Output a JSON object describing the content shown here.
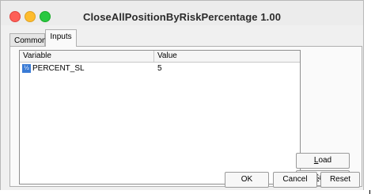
{
  "window": {
    "title": "CloseAllPositionByRiskPercentage 1.00"
  },
  "tabs": [
    {
      "label": "Common"
    },
    {
      "label": "Inputs"
    }
  ],
  "table": {
    "columns": [
      "Variable",
      "Value"
    ],
    "rows": [
      {
        "icon": "parameter-type-icon",
        "variable": "PERCENT_SL",
        "value": "5"
      }
    ]
  },
  "buttons": {
    "load": {
      "first": "L",
      "rest": "oad"
    },
    "save": {
      "first": "S",
      "rest": "ave"
    },
    "ok": "OK",
    "cancel": "Cancel",
    "reset": "Reset"
  },
  "colors": {
    "close": "#fe5f57",
    "minimize": "#febc2e",
    "zoom": "#28c840",
    "param_icon": "#3a7bd5"
  }
}
